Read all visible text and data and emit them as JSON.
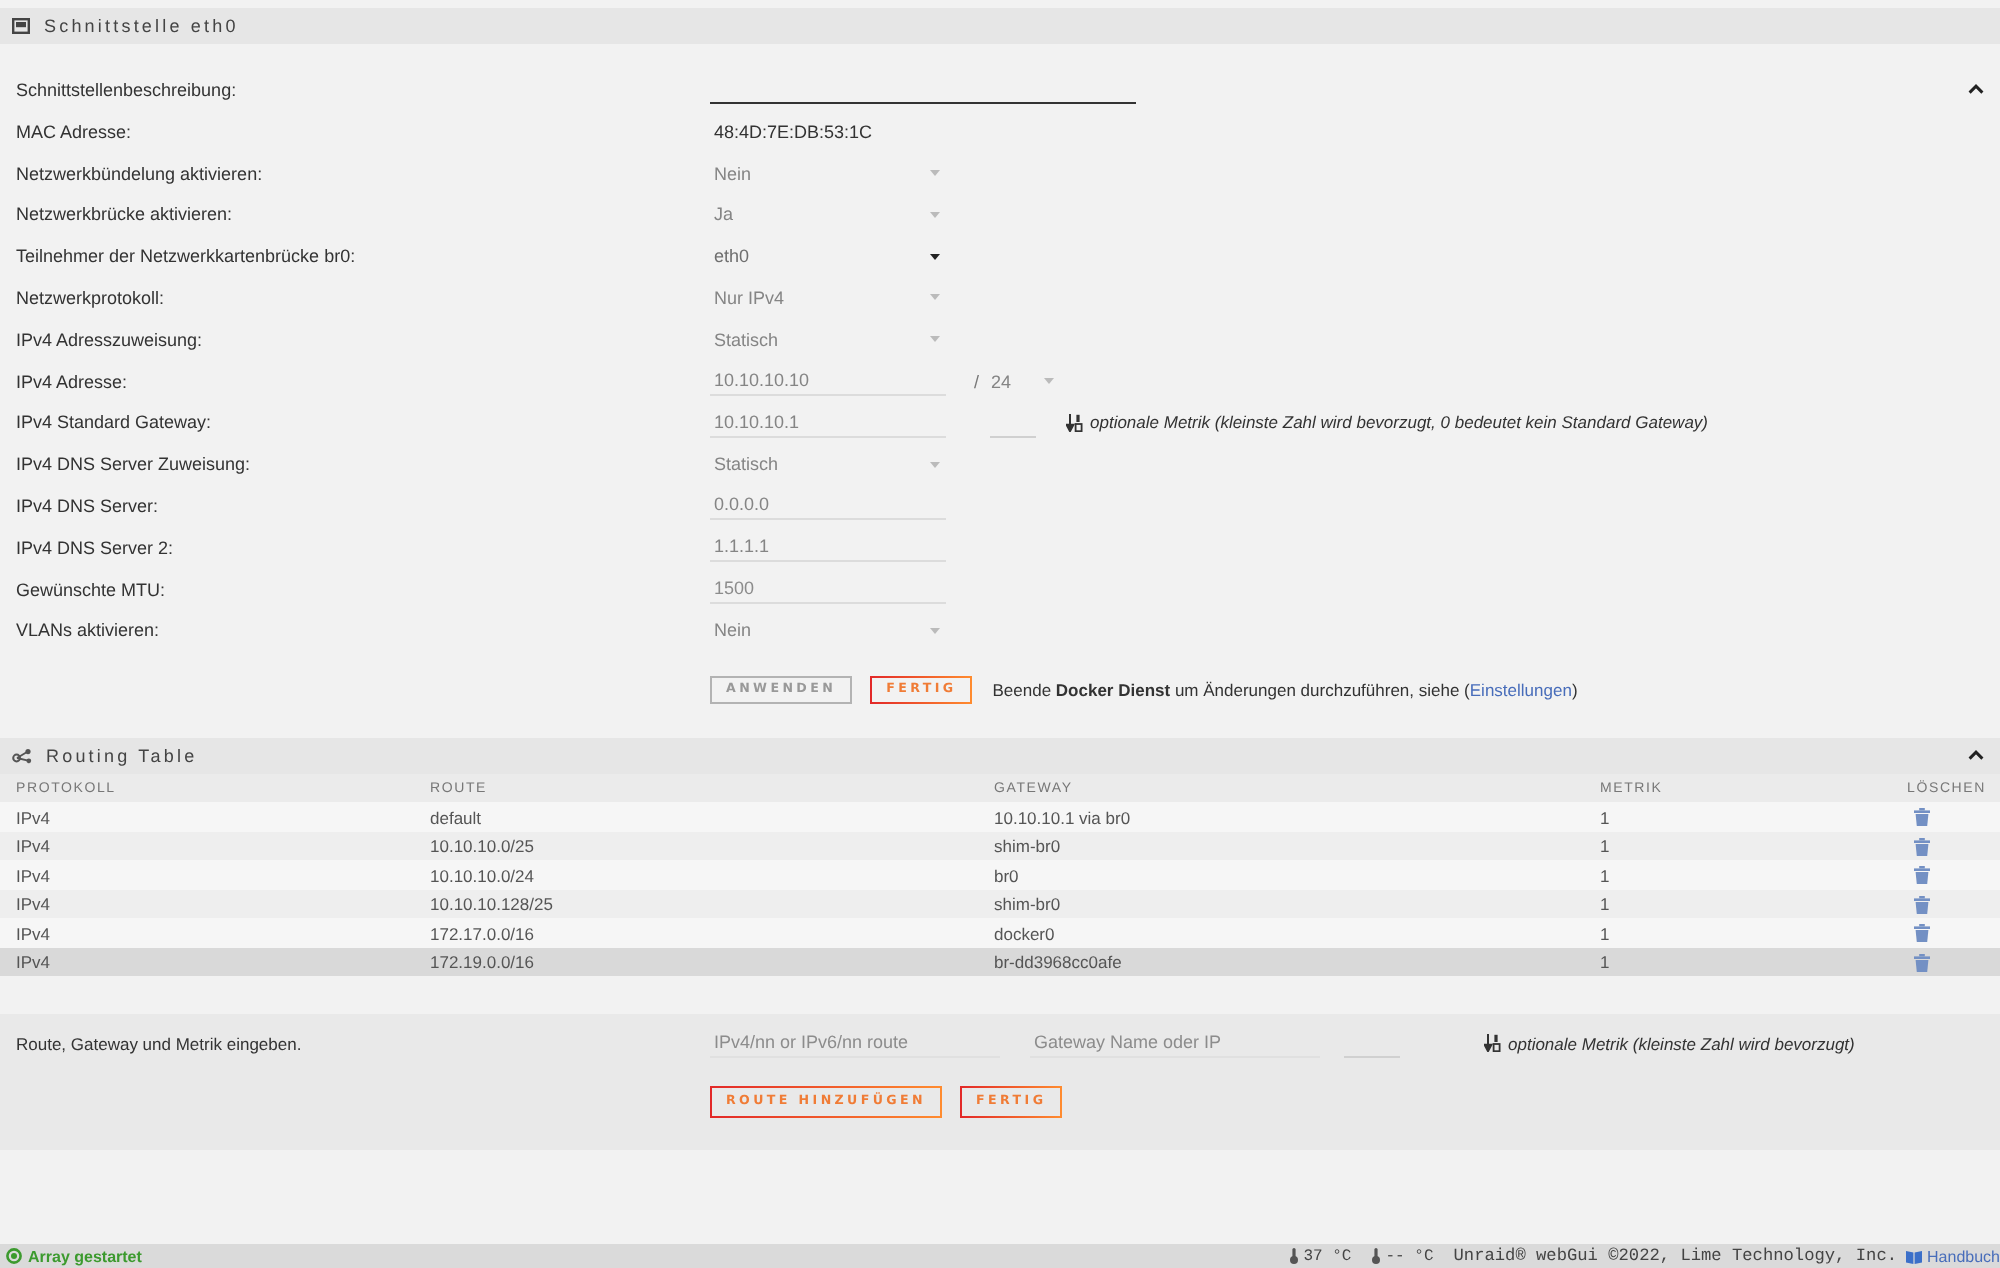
{
  "interface_panel": {
    "title": "Schnittstelle eth0",
    "expanded": true,
    "rows": [
      {
        "label": "Schnittstellenbeschreibung:",
        "kind": "wide_input",
        "disabled": false
      },
      {
        "label": "MAC Adresse:",
        "kind": "text",
        "value": "48:4D:7E:DB:53:1C",
        "disabled": false
      },
      {
        "label": "Netzwerkbündelung aktivieren:",
        "kind": "select",
        "value": "Nein",
        "disabled": true
      },
      {
        "label": "Netzwerkbrücke aktivieren:",
        "kind": "select",
        "value": "Ja",
        "disabled": true
      },
      {
        "label": "Teilnehmer der Netzwerkkartenbrücke br0:",
        "kind": "select",
        "value": "eth0",
        "disabled": false
      },
      {
        "label": "Netzwerkprotokoll:",
        "kind": "select",
        "value": "Nur IPv4",
        "disabled": true
      },
      {
        "label": "IPv4 Adresszuweisung:",
        "kind": "select",
        "value": "Statisch",
        "disabled": true
      },
      {
        "label": "IPv4 Adresse:",
        "kind": "address",
        "value": "10.10.10.10",
        "separator": "/",
        "netmask": "24",
        "disabled": true
      },
      {
        "label": "IPv4 Standard Gateway:",
        "kind": "gateway",
        "value": "10.10.10.1",
        "hint": "optionale Metrik (kleinste Zahl wird bevorzugt, 0 bedeutet kein Standard Gateway)",
        "disabled": true
      },
      {
        "label": "IPv4 DNS Server Zuweisung:",
        "kind": "select",
        "value": "Statisch",
        "disabled": true
      },
      {
        "label": "IPv4 DNS Server:",
        "kind": "input",
        "value": "0.0.0.0",
        "disabled": true
      },
      {
        "label": "IPv4 DNS Server 2:",
        "kind": "input",
        "value": "1.1.1.1",
        "disabled": true
      },
      {
        "label": "Gewünschte MTU:",
        "kind": "input",
        "placeholder": "1500",
        "disabled": true
      },
      {
        "label": "VLANs aktivieren:",
        "kind": "select",
        "value": "Nein",
        "disabled": true
      }
    ],
    "buttons": [
      {
        "label": "ANWENDEN",
        "disabled": true
      },
      {
        "label": "FERTIG",
        "disabled": false
      }
    ],
    "notice": {
      "text": "Beende **Docker Dienst** um Änderungen durchzuführen, siehe (",
      "link": "Einstellungen",
      "text_after": ")"
    }
  },
  "routing_panel": {
    "title": "Routing Table",
    "expanded": true,
    "table": {
      "columns": [
        "PROTOKOLL",
        "ROUTE",
        "GATEWAY",
        "METRIK",
        "LÖSCHEN"
      ],
      "rows": [
        {
          "protocol": "IPv4",
          "route": "default",
          "gateway": "10.10.10.1 via br0",
          "metric": "1",
          "selected": false
        },
        {
          "protocol": "IPv4",
          "route": "10.10.10.0/25",
          "gateway": "shim-br0",
          "metric": "1",
          "selected": false
        },
        {
          "protocol": "IPv4",
          "route": "10.10.10.0/24",
          "gateway": "br0",
          "metric": "1",
          "selected": false
        },
        {
          "protocol": "IPv4",
          "route": "10.10.10.128/25",
          "gateway": "shim-br0",
          "metric": "1",
          "selected": false
        },
        {
          "protocol": "IPv4",
          "route": "172.17.0.0/16",
          "gateway": "docker0",
          "metric": "1",
          "selected": false
        },
        {
          "protocol": "IPv4",
          "route": "172.19.0.0/16",
          "gateway": "br-dd3968cc0afe",
          "metric": "1",
          "selected": true
        }
      ]
    },
    "add_route": {
      "label": "Route, Gateway und Metrik eingeben.",
      "route_field": {
        "placeholder": "IPv4/nn or IPv6/nn route"
      },
      "gateway_field": {
        "placeholder": "Gateway Name oder IP"
      },
      "metric_hint": "optionale Metrik (kleinste Zahl wird bevorzugt)",
      "buttons": [
        {
          "label": "ROUTE HINZUFÜGEN",
          "disabled": false
        },
        {
          "label": "FERTIG",
          "disabled": false
        }
      ]
    }
  },
  "status_bar": {
    "array_status": "Array gestartet",
    "temperatures": [
      "37 °C",
      "-- °C"
    ],
    "copyright": "Unraid® webGui ©2022, Lime Technology, Inc.",
    "manual_link": "Handbuch"
  }
}
